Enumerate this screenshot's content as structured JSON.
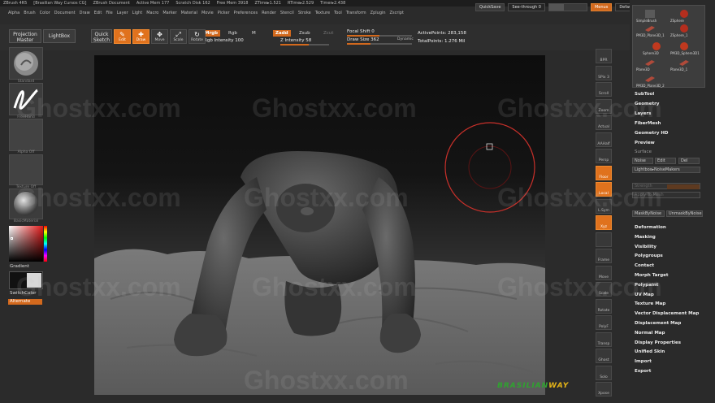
{
  "titlebar": {
    "app": "ZBrush 4R5",
    "doc_owner": "[Brasilian Way Cursos CG]",
    "document": "ZBrush Document",
    "active_mem": "Active Mem 177",
    "scratch_disk": "Scratch Disk 162",
    "free_mem": "Free Mem 3918",
    "ztime": "ZTime▸1.521",
    "rtime": "RTime▸2.529",
    "timer": "Timer▸2.438"
  },
  "menus": [
    "Alpha",
    "Brush",
    "Color",
    "Document",
    "Draw",
    "Edit",
    "File",
    "Layer",
    "Light",
    "Macro",
    "Marker",
    "Material",
    "Movie",
    "Picker",
    "Preferences",
    "Render",
    "Stencil",
    "Stroke",
    "Texture",
    "Tool",
    "Transform",
    "Zplugin",
    "Zscript"
  ],
  "top_controls": {
    "quicksave": "QuickSave",
    "seethrough": "See-through",
    "seethrough_value": "0",
    "menus": "Menus",
    "script": "DefaultZScript"
  },
  "toolbar": {
    "projection_master": "Projection Master",
    "lightbox": "LightBox",
    "quick_sketch": "Quick Sketch",
    "tools": [
      {
        "label": "Edit",
        "glyph": "✎",
        "active": true
      },
      {
        "label": "Draw",
        "glyph": "✚",
        "active": true
      },
      {
        "label": "Move",
        "glyph": "✥",
        "active": false
      },
      {
        "label": "Scale",
        "glyph": "⤢",
        "active": false
      },
      {
        "label": "Rotate",
        "glyph": "↻",
        "active": false
      }
    ],
    "mrgb": "Mrgb",
    "rgb": "Rgb",
    "m": "M",
    "rgb_intensity_label": "Rgb Intensity",
    "rgb_intensity": "100",
    "zadd": "Zadd",
    "zsub": "Zsub",
    "zcut": "Zcut",
    "z_intensity_label": "Z Intensity",
    "z_intensity": "58",
    "focal_shift_label": "Focal Shift",
    "focal_shift": "0",
    "draw_size_label": "Draw Size",
    "draw_size": "362",
    "dynamic": "Dynamic",
    "active_points": "ActivePoints: 283,158",
    "total_points": "TotalPoints: 1.276 Mil"
  },
  "left_shelf": {
    "items": [
      "Standard",
      "FreeHand",
      "Alpha Off",
      "Texture Off",
      "BasicMaterial"
    ],
    "gradient": "Gradient",
    "switch_color": "SwitchColor",
    "alternate": "Alternate"
  },
  "right_shelf": [
    "BPR",
    "SPix 3",
    "Scroll",
    "Zoom",
    "Actual",
    "AAHalf",
    "Persp",
    "Floor",
    "Local",
    "L.Sym",
    "Xyz",
    "",
    "Frame",
    "Move",
    "Scale",
    "Rotate",
    "PolyF",
    "Transp",
    "Ghost",
    "Solo",
    "Xpose"
  ],
  "subtool_thumbs": [
    {
      "label": "SimpleBrush",
      "kind": "brush"
    },
    {
      "label": "ZSphere",
      "kind": "zsphere"
    },
    {
      "label": "PM3D_Plane3D_1",
      "kind": "plane"
    },
    {
      "label": "ZSphere_1",
      "kind": "zsphere"
    },
    {
      "label": "Sphere3D",
      "kind": "sphere"
    },
    {
      "label": "PM3D_Sphere3D1",
      "kind": "sphere"
    },
    {
      "label": "Plane3D",
      "kind": "plane"
    },
    {
      "label": "Plane3D_1",
      "kind": "plane"
    },
    {
      "label": "PM3D_Plane3D_2",
      "kind": "plane"
    }
  ],
  "tool_menu": {
    "top": [
      "SubTool",
      "Geometry",
      "Layers",
      "FiberMesh",
      "Geometry HD",
      "Preview"
    ],
    "surface": "Surface",
    "noise_btn": "Noise",
    "edit_btn": "Edit",
    "del_btn": "Del",
    "lightbox_noisemakers": "Lightbox▸NoiseMakers",
    "strength": "Strength",
    "apply_to_mesh": "Apply To Mesh",
    "mask_by_noise": "MaskByNoise",
    "unmask_by_noise": "UnmaskByNoise",
    "bottom": [
      "Deformation",
      "Masking",
      "Visibility",
      "Polygroups",
      "Contact",
      "Morph Target",
      "Polypaint",
      "UV Map",
      "Texture Map",
      "Vector Displacement Map",
      "Displacement Map",
      "Normal Map",
      "Display Properties",
      "Unified Skin",
      "Import",
      "Export"
    ]
  },
  "watermark": "Ghostxx.com",
  "brand": {
    "part1": "BRASILIAN",
    "part2": "WAY"
  },
  "colors": {
    "accent": "#e0721d",
    "brush_circle": "#c8302a",
    "brand_green": "#2fa32f",
    "brand_yellow": "#e5b418"
  }
}
